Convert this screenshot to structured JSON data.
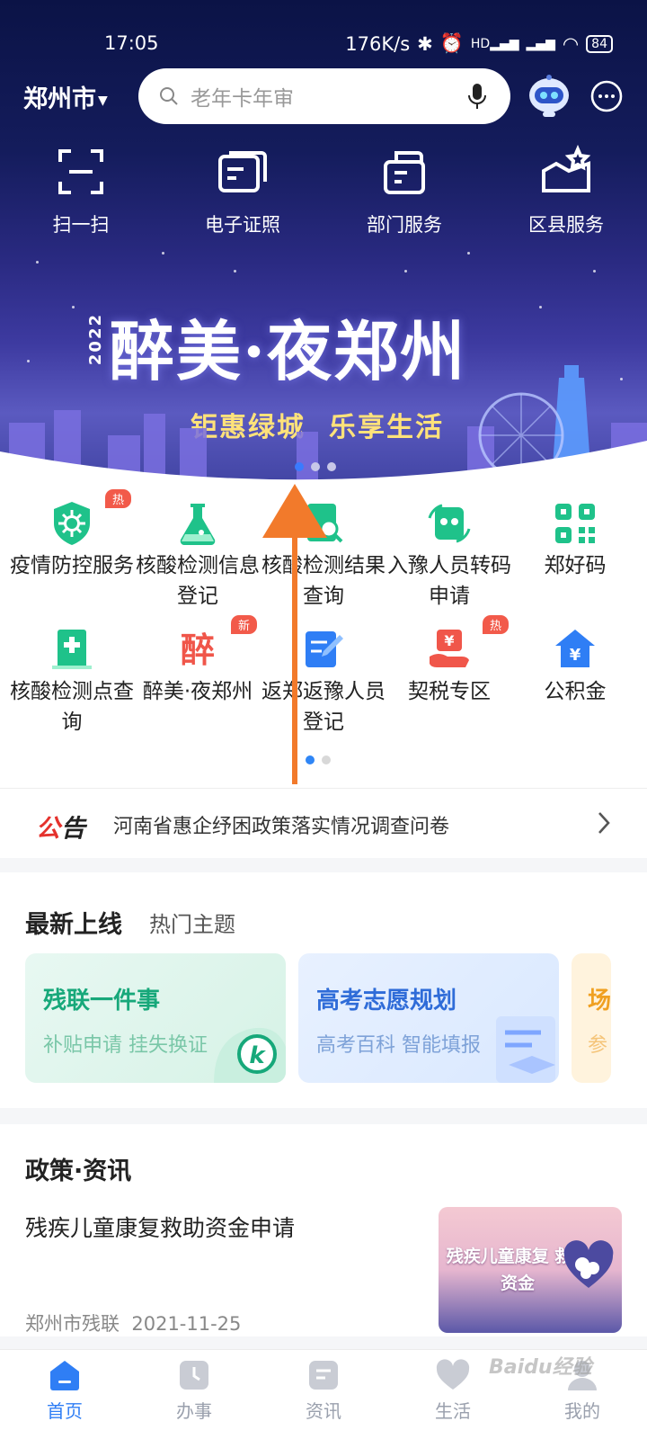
{
  "status_bar": {
    "time": "17:05",
    "speed": "176K/s",
    "network": "HD",
    "battery": "84"
  },
  "top_bar": {
    "city": "郑州市",
    "search": {
      "placeholder": "老年卡年审"
    }
  },
  "quick_actions": [
    {
      "label": "扫一扫",
      "icon": "scan-icon"
    },
    {
      "label": "电子证照",
      "icon": "id-card-icon"
    },
    {
      "label": "部门服务",
      "icon": "department-icon"
    },
    {
      "label": "区县服务",
      "icon": "district-icon"
    }
  ],
  "banner": {
    "year": "2022",
    "title": "醉美·夜郑州",
    "subtitle_a": "钜惠绿城",
    "subtitle_b": "乐享生活",
    "pages": 3,
    "active_page": 1
  },
  "services": [
    {
      "label": "疫情防控服务",
      "tag": "热",
      "icon": "virus-shield-icon"
    },
    {
      "label": "核酸检测信息登记",
      "tag": "",
      "icon": "flask-icon"
    },
    {
      "label": "核酸检测结果查询",
      "tag": "",
      "icon": "document-search-icon"
    },
    {
      "label": "入豫人员转码申请",
      "tag": "",
      "icon": "transfer-icon"
    },
    {
      "label": "郑好码",
      "tag": "",
      "icon": "qr-code-icon"
    },
    {
      "label": "核酸检测点查询",
      "tag": "",
      "icon": "hospital-icon"
    },
    {
      "label": "醉美·夜郑州",
      "tag": "新",
      "icon": "drunk-char-icon"
    },
    {
      "label": "返郑返豫人员登记",
      "tag": "",
      "icon": "edit-form-icon"
    },
    {
      "label": "契税专区",
      "tag": "热",
      "icon": "tax-hand-icon"
    },
    {
      "label": "公积金",
      "tag": "",
      "icon": "house-fund-icon"
    }
  ],
  "service_pages": {
    "total": 2,
    "active": 1
  },
  "notice": {
    "tag_a": "公",
    "tag_b": "告",
    "text": "河南省惠企纾困政策落实情况调查问卷"
  },
  "latest": {
    "title": "最新上线",
    "subtitle": "热门主题",
    "cards": [
      {
        "title": "残联一件事",
        "sub": "补贴申请 挂失换证"
      },
      {
        "title": "高考志愿规划",
        "sub": "高考百科 智能填报"
      },
      {
        "title": "场",
        "sub": "参"
      }
    ]
  },
  "news": {
    "section_title": "政策·资讯",
    "items": [
      {
        "title": "残疾儿童康复救助资金申请",
        "source": "郑州市残联",
        "date": "2021-11-25",
        "thumb_text": "残疾儿童康复 救助资金"
      }
    ]
  },
  "tab_bar": [
    {
      "label": "首页",
      "active": true,
      "icon": "home-icon"
    },
    {
      "label": "办事",
      "active": false,
      "icon": "clock-icon"
    },
    {
      "label": "资讯",
      "active": false,
      "icon": "news-icon"
    },
    {
      "label": "生活",
      "active": false,
      "icon": "heart-icon"
    },
    {
      "label": "我的",
      "active": false,
      "icon": "profile-icon"
    }
  ],
  "watermark": "Baidu经验",
  "colors": {
    "accent": "#2f7ef5",
    "hero_bg": "#141c5c",
    "hot_tag": "#f25a4a",
    "service_green": "#1fc28a"
  }
}
